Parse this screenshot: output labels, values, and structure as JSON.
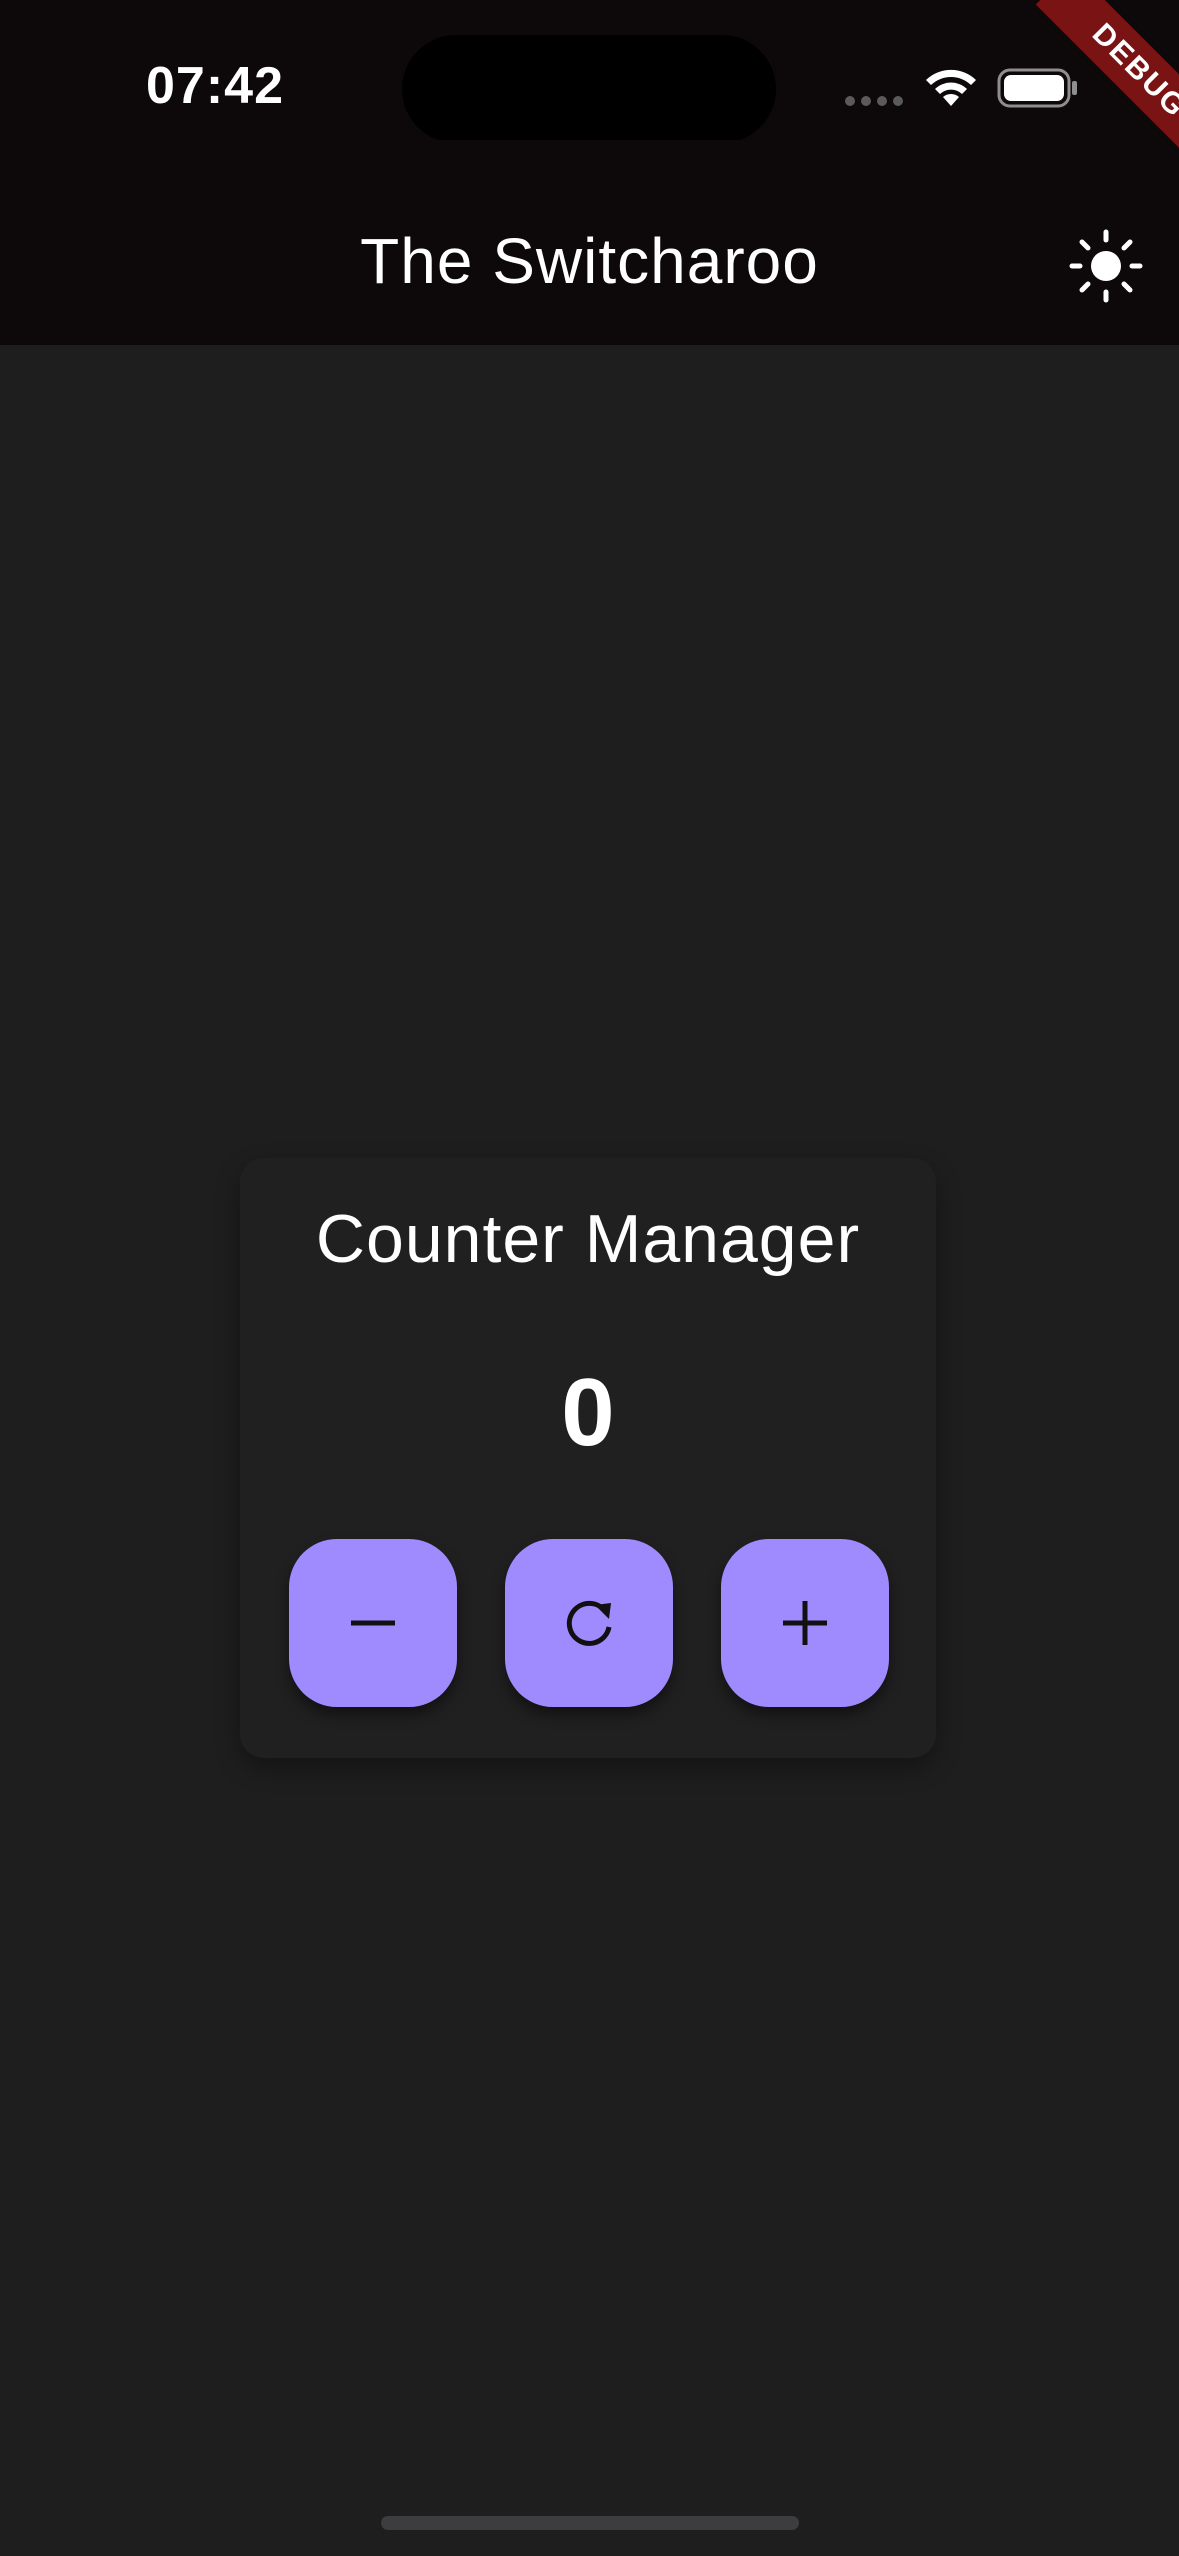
{
  "status_bar": {
    "time": "07:42",
    "icons": [
      "cellular-dots-icon",
      "wifi-icon",
      "battery-icon"
    ]
  },
  "app_bar": {
    "title": "The Switcharoo",
    "theme_toggle_icon": "sun-icon"
  },
  "debug_banner": {
    "label": "DEBUG",
    "color": "#7a1313"
  },
  "counter_card": {
    "title": "Counter Manager",
    "value": "0",
    "buttons": [
      {
        "name": "decrement",
        "icon": "minus-icon"
      },
      {
        "name": "reset",
        "icon": "refresh-icon"
      },
      {
        "name": "increment",
        "icon": "plus-icon"
      }
    ]
  },
  "colors": {
    "background": "#1e1e1f",
    "app_bar": "#0d080a",
    "card": "#202021",
    "button": "#9f8afe",
    "text": "#ffffff"
  }
}
